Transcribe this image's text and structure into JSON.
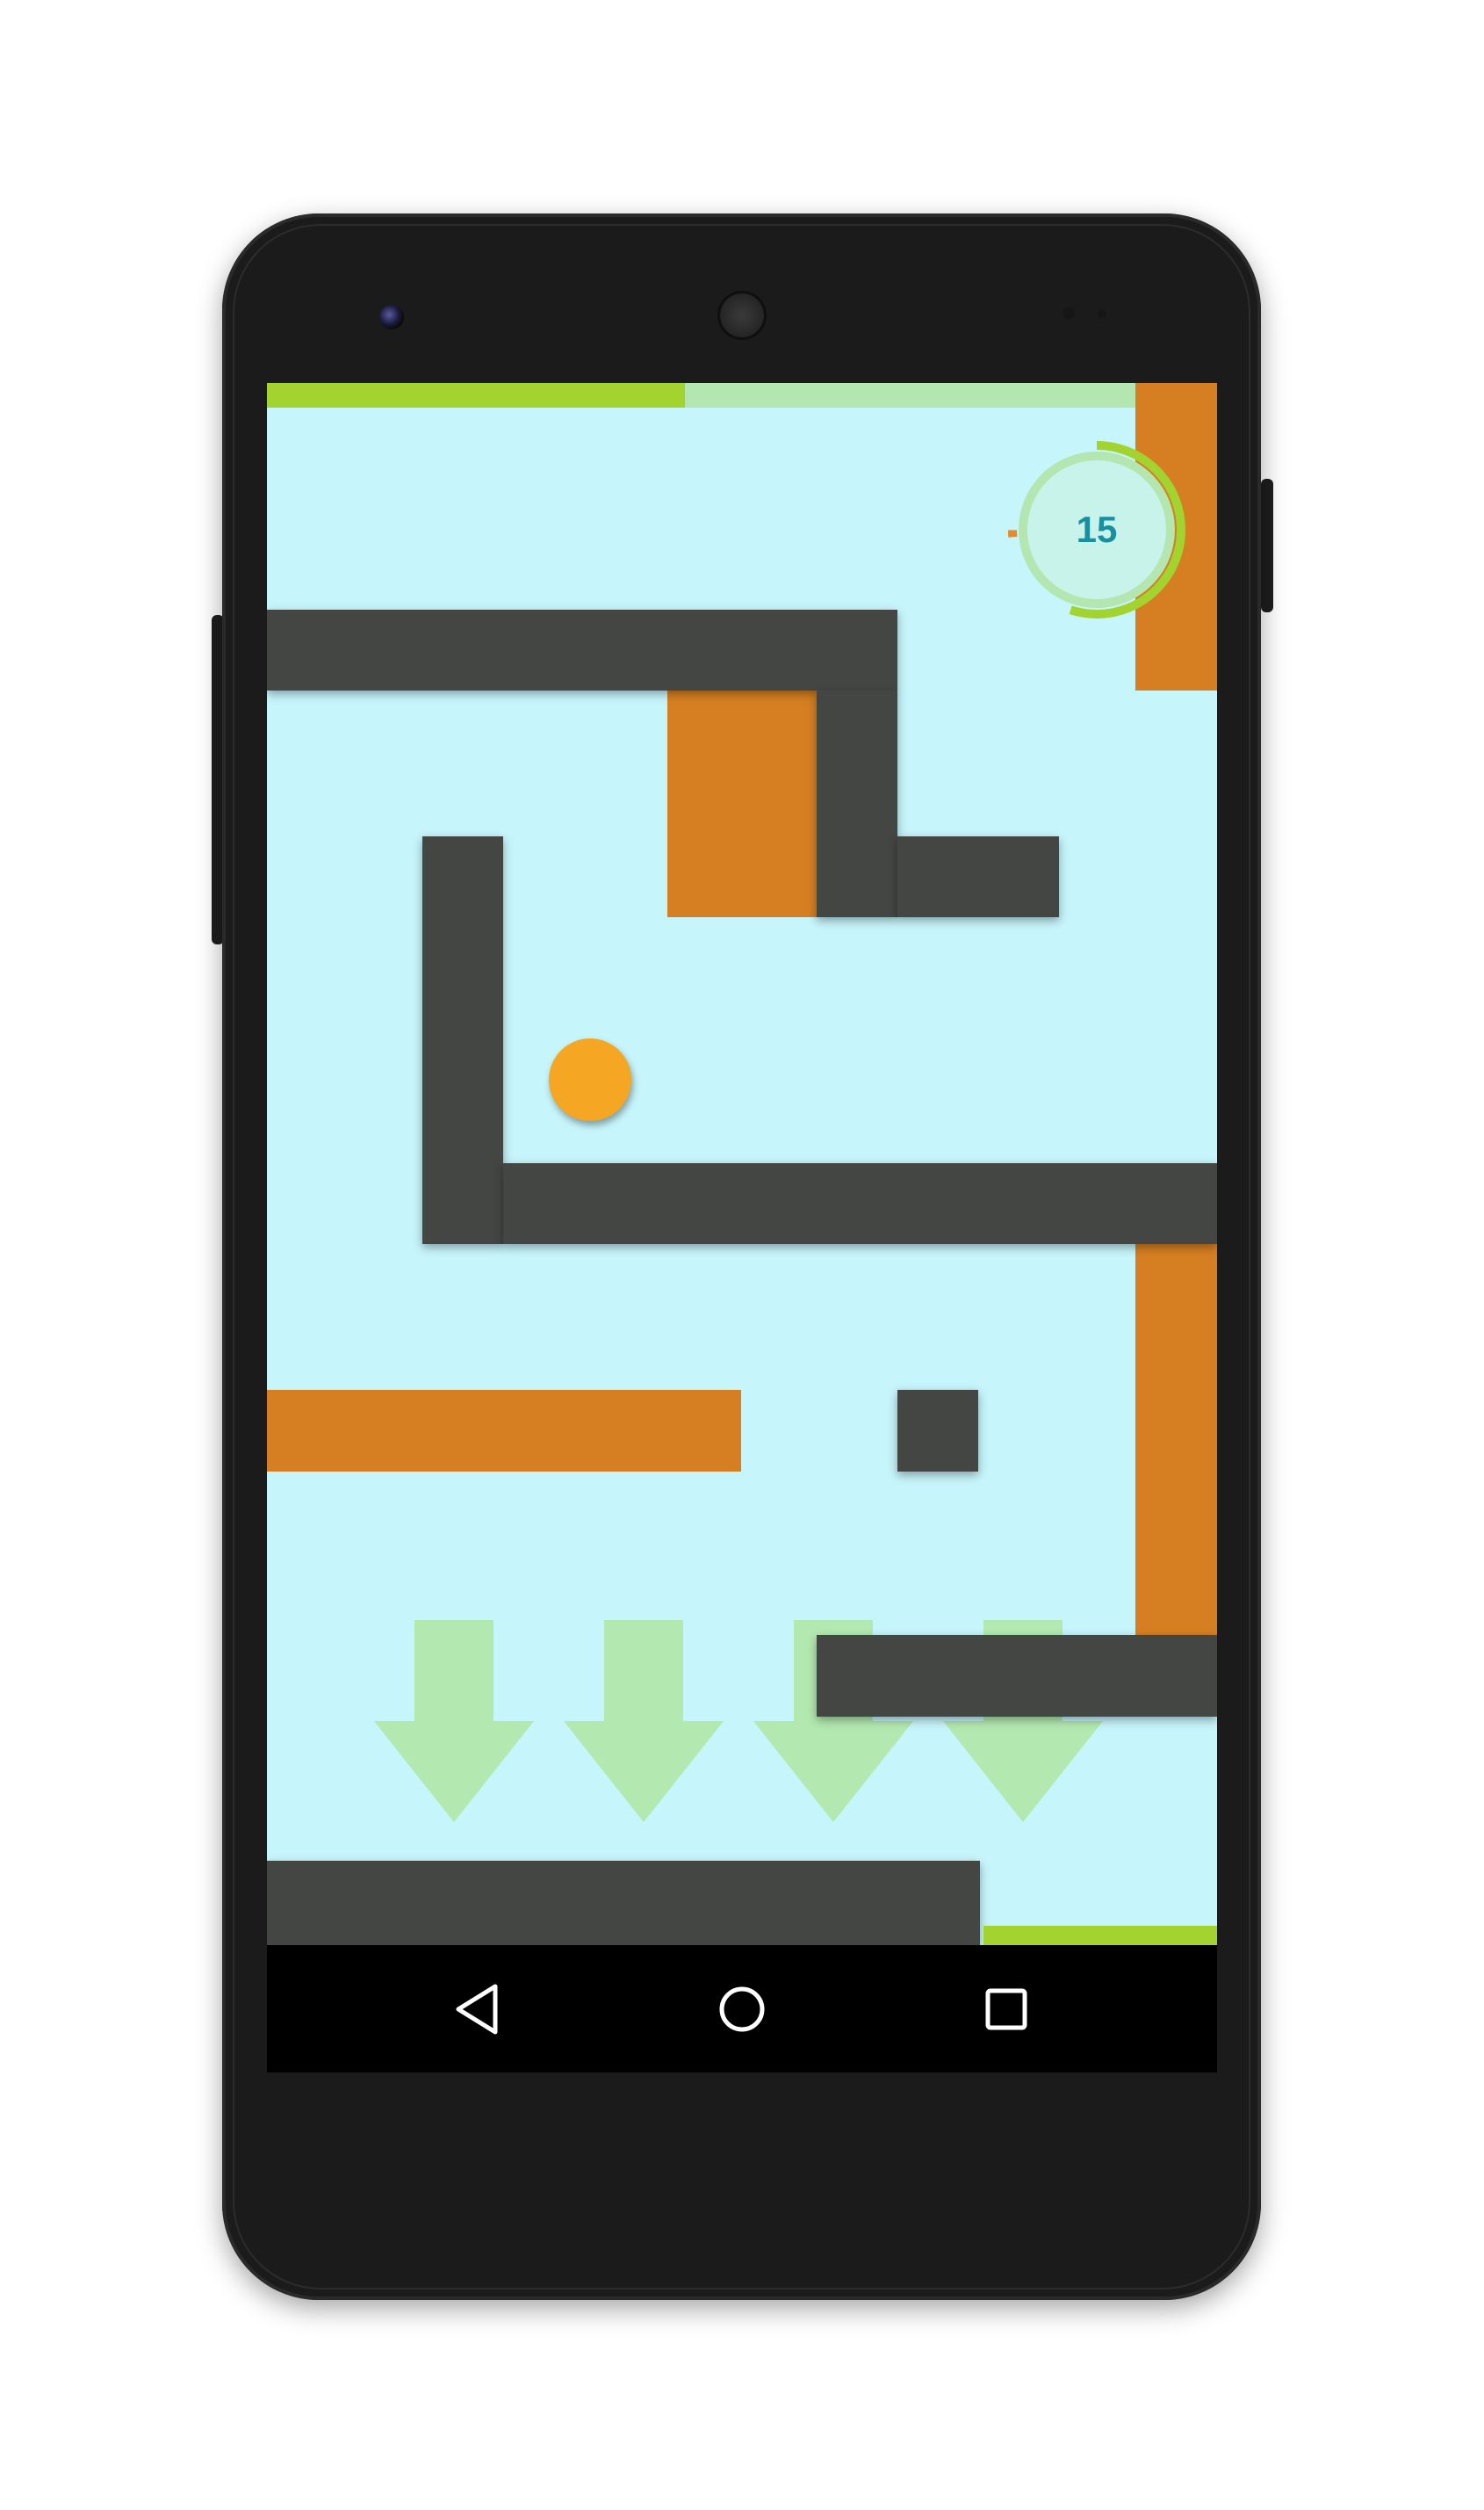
{
  "game": {
    "level_progress": 0.44,
    "timer": {
      "value": "15",
      "remaining_fraction": 0.55
    },
    "colors": {
      "background": "#c6f5fb",
      "wall": "#444644",
      "block": "#d57f22",
      "ball": "#f5a623",
      "progress": "#a2d32e",
      "progress_track": "#b3e6b0",
      "arrow": "#b3e9b0",
      "timer_text": "#1a8f9d"
    },
    "gravity_arrows": {
      "count": 4,
      "direction": "down"
    }
  },
  "navbar": {
    "buttons": [
      {
        "name": "back",
        "icon": "back-triangle-icon"
      },
      {
        "name": "home",
        "icon": "home-circle-icon"
      },
      {
        "name": "recents",
        "icon": "recents-square-icon"
      }
    ]
  }
}
